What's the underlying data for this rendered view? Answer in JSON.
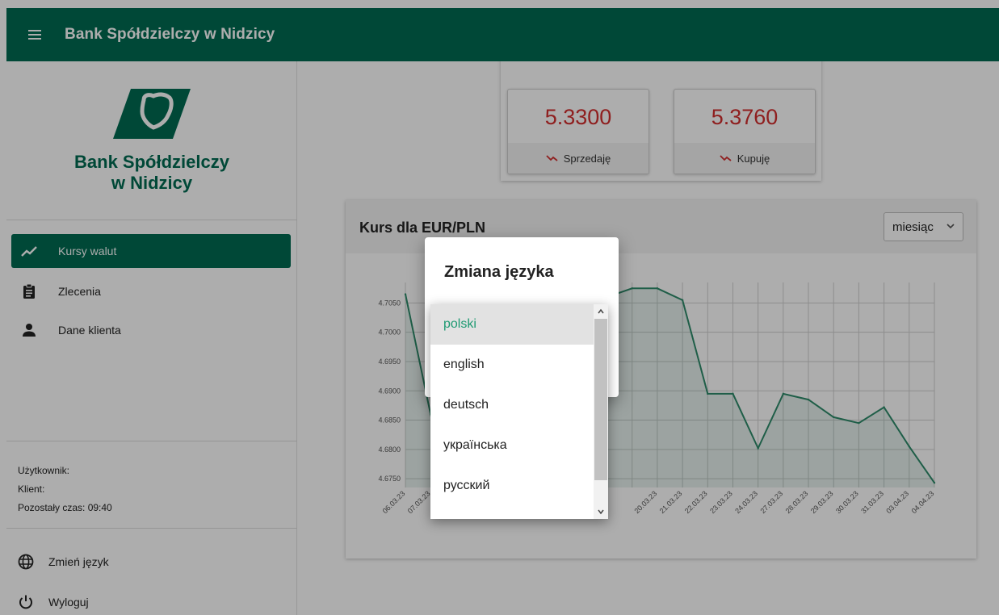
{
  "app": {
    "title": "Bank Spółdzielczy w Nidzicy"
  },
  "colors": {
    "brand": "#006b52",
    "rate_text": "#d32f2f",
    "chart_line": "#2e8b6a",
    "selected_option": "#1e9a72"
  },
  "sidebar": {
    "logo_text_line1": "Bank Spółdzielczy",
    "logo_text_line2": "w Nidzicy",
    "nav": [
      {
        "label": "Kursy walut",
        "icon": "trending-up-icon",
        "active": true
      },
      {
        "label": "Zlecenia",
        "icon": "clipboard-icon",
        "active": false
      },
      {
        "label": "Dane klienta",
        "icon": "person-icon",
        "active": false
      }
    ],
    "user_label": "Użytkownik:",
    "client_label": "Klient:",
    "time_left": "Pozostały czas: 09:40",
    "change_language": "Zmień język",
    "logout": "Wyloguj"
  },
  "rates": {
    "sell_value": "5.3300",
    "sell_label": "Sprzedaję",
    "buy_value": "5.3760",
    "buy_label": "Kupuję"
  },
  "chart_panel": {
    "title": "Kurs dla EUR/PLN",
    "period_selected": "miesiąc"
  },
  "dialog": {
    "title": "Zmiana języka",
    "options": [
      "polski",
      "english",
      "deutsch",
      "українська",
      "русский"
    ],
    "selected_index": 0
  },
  "chart_data": {
    "type": "area",
    "title": "Kurs dla EUR/PLN",
    "xlabel": "",
    "ylabel": "",
    "y_ticks": [
      "4.6750",
      "4.6800",
      "4.6850",
      "4.6900",
      "4.6950",
      "4.7000",
      "4.7050"
    ],
    "ylim": [
      4.6735,
      4.7085
    ],
    "grid": true,
    "x": [
      "06.03.23",
      "07.03.23",
      "08.03.23",
      "09.03.23",
      "10.03.23",
      "13.03.23",
      "14.03.23",
      "15.03.23",
      "16.03.23",
      "17.03.23",
      "20.03.23",
      "21.03.23",
      "22.03.23",
      "23.03.23",
      "24.03.23",
      "27.03.23",
      "28.03.23",
      "29.03.23",
      "30.03.23",
      "31.03.23",
      "03.04.23",
      "04.04.23"
    ],
    "x_visible_labels": [
      "06.03.23",
      "07.03.23",
      "08.03.23",
      "20.03.23",
      "21.03.23",
      "22.03.23",
      "23.03.23",
      "24.03.23",
      "27.03.23",
      "28.03.23",
      "29.03.23",
      "30.03.23",
      "31.03.23",
      "03.04.23",
      "04.04.23"
    ],
    "values": [
      4.7065,
      4.686,
      4.6945,
      4.695,
      4.696,
      4.6985,
      4.7005,
      4.703,
      4.706,
      4.7075,
      4.7075,
      4.7055,
      4.6895,
      4.6895,
      4.6802,
      4.6895,
      4.6885,
      4.6855,
      4.6845,
      4.6872,
      4.6805,
      4.6743
    ]
  }
}
